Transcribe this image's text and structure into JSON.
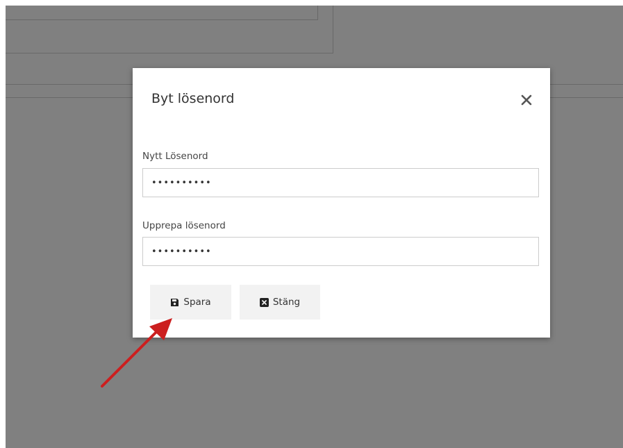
{
  "dialog": {
    "title": "Byt lösenord",
    "close_icon": "close-icon"
  },
  "form": {
    "new_password": {
      "label": "Nytt Lösenord",
      "value": "••••••••••"
    },
    "repeat_password": {
      "label": "Upprepa lösenord",
      "value": "••••••••••"
    }
  },
  "buttons": {
    "save": {
      "label": "Spara",
      "icon": "save-icon"
    },
    "close": {
      "label": "Stäng",
      "icon": "close-square-icon"
    }
  },
  "colors": {
    "backdrop": "#808080",
    "button_bg": "#f2f2f2",
    "arrow": "#cc1f1f"
  }
}
